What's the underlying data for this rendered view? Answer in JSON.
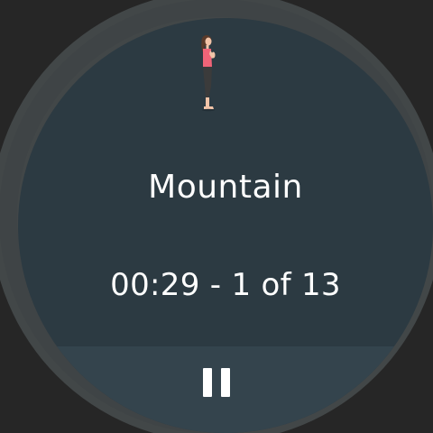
{
  "exercise": {
    "name": "Mountain",
    "timer_text": "00:29 - 1 of 13",
    "figure_icon": "woman-standing-prayer-pose-icon"
  },
  "controls": {
    "pause_icon": "pause-icon"
  },
  "colors": {
    "background": "#262626",
    "bezel": "#424748",
    "screen": "#2c3a42",
    "control_bar": "#34444d",
    "progress_track": "#4a5a62",
    "text": "#ffffff"
  }
}
